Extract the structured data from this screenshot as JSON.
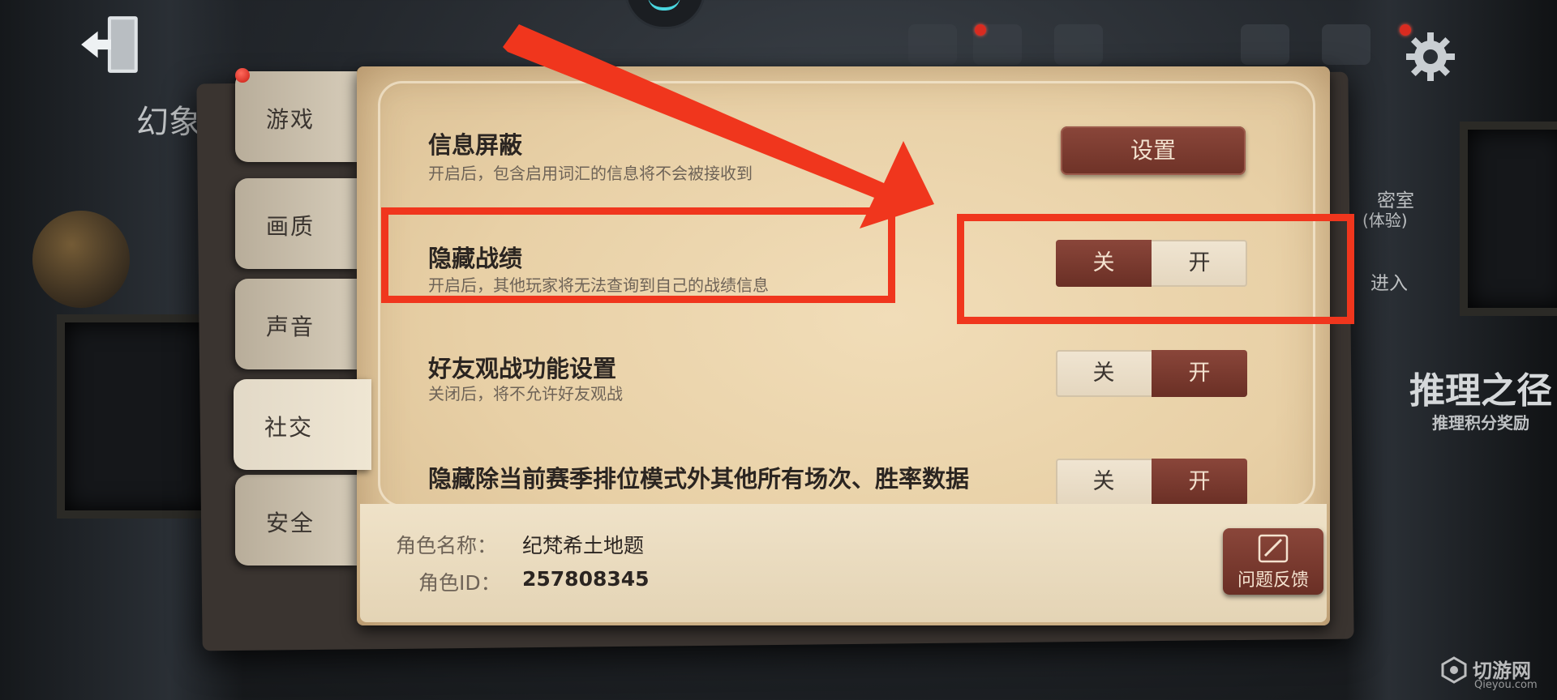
{
  "background": {
    "left_title": "幻象",
    "right_room_title": "密室",
    "right_room_sub": "(体验)",
    "right_enter": "进入",
    "right_big_title": "推理之径",
    "right_big_sub": "推理积分奖励"
  },
  "tabs": [
    {
      "label": "游戏",
      "active": false
    },
    {
      "label": "画质",
      "active": false
    },
    {
      "label": "声音",
      "active": false
    },
    {
      "label": "社交",
      "active": true
    },
    {
      "label": "安全",
      "active": false
    }
  ],
  "settings": {
    "block": {
      "title": "信息屏蔽",
      "desc": "开启后，包含启用词汇的信息将不会被接收到",
      "button": "设置"
    },
    "hide_record": {
      "title": "隐藏战绩",
      "desc": "开启后，其他玩家将无法查询到自己的战绩信息",
      "off": "关",
      "on": "开",
      "value": "关"
    },
    "friend_spectate": {
      "title": "好友观战功能设置",
      "desc": "关闭后，将不允许好友观战",
      "off": "关",
      "on": "开",
      "value": "开"
    },
    "hide_other_stats": {
      "title": "隐藏除当前赛季排位模式外其他所有场次、胜率数据",
      "off": "关",
      "on": "开",
      "value": "开"
    }
  },
  "role": {
    "name_label": "角色名称：",
    "name_value": "纪梵希土地题",
    "id_label": "角色ID：",
    "id_value": "257808345"
  },
  "feedback": {
    "label": "问题反馈"
  },
  "watermark": {
    "title": "切游网",
    "url": "Qieyou.com"
  },
  "colors": {
    "accent": "#7a3b30",
    "annotation": "#f0361d",
    "page": "#ecd6ae"
  }
}
